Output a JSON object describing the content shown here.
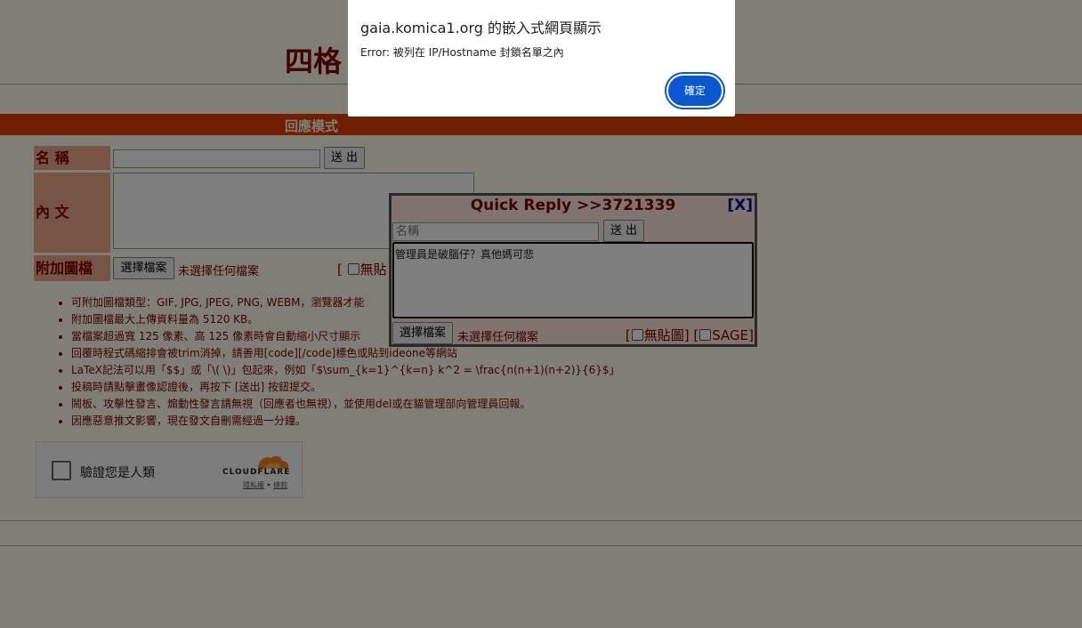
{
  "board": {
    "title": "四格"
  },
  "mode_bar": {
    "label": "回應模式"
  },
  "post_form": {
    "name_label": "名 稱",
    "submit_label": "送 出",
    "content_label": "內 文",
    "attachment_label": "附加圖檔",
    "file_button": "選擇檔案",
    "file_status": "未選擇任何檔案",
    "no_image_label": "無貼"
  },
  "rules": [
    "可附加圖檔類型：GIF, JPG, JPEG, PNG, WEBM，瀏覽器才能",
    "附加圖檔最大上傳資料量為 5120 KB。",
    "當檔案超過寬 125 像素、高 125 像素時會自動縮小尺寸顯示",
    "回覆時程式碼縮排會被trim消掉，請善用[code][/code]標色或貼到ideone等網站",
    "LaTeX記法可以用「$$」或「\\( \\)」包起來，例如「$\\sum_{k=1}^{k=n} k^2 = \\frac{n(n+1)(n+2)}{6}$」",
    "投稿時請點擊畫像認證後，再按下 [送出] 按鈕提交。",
    "鬧板、攻擊性發言、煽動性發言請無視（回應者也無視），並使用del或在貓管理部向管理員回報。",
    "因應惡意推文影響，現在發文自刪需經過一分鐘。"
  ],
  "captcha": {
    "label": "驗證您是人類",
    "brand": "CLOUDFLARE",
    "privacy_link": "隱私權",
    "terms_link": "條款",
    "separator": "•"
  },
  "quick_reply": {
    "title": "Quick Reply >>3721339",
    "close_label": "[X]",
    "name_placeholder": "名稱",
    "submit_label": "送 出",
    "body_text": "管理員是破腦仔？真他媽可悲",
    "file_button": "選擇檔案",
    "file_status": "未選擇任何檔案",
    "no_image_label": "無貼圖",
    "sage_label": "SAGE"
  },
  "dialog": {
    "title": "gaia.komica1.org 的嵌入式網頁顯示",
    "message": "Error: 被列在 IP/Hostname 封鎖名單之內",
    "ok_label": "確定",
    "accent": "#0b57d0"
  }
}
